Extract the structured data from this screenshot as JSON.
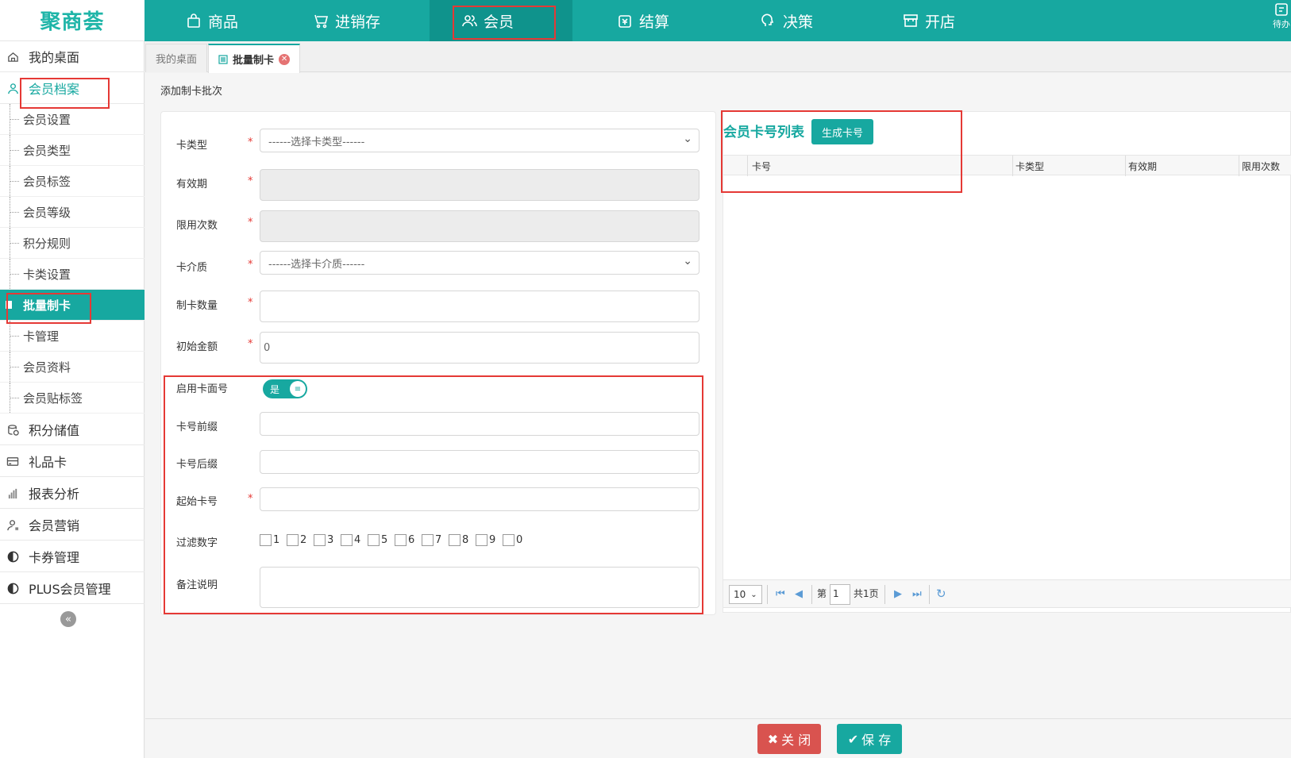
{
  "brand": {
    "logo_text": "聚商荟"
  },
  "topnav": [
    {
      "label": "商品",
      "icon": "bag-icon"
    },
    {
      "label": "进销存",
      "icon": "shelf-icon"
    },
    {
      "label": "会员",
      "icon": "users-icon",
      "active": true
    },
    {
      "label": "结算",
      "icon": "wallet-icon"
    },
    {
      "label": "决策",
      "icon": "brain-icon"
    },
    {
      "label": "开店",
      "icon": "store-icon"
    }
  ],
  "topnav_right_label": "待办",
  "sidebar": {
    "home": "我的桌面",
    "member_files": "会员档案",
    "sub_items": [
      "会员设置",
      "会员类型",
      "会员标签",
      "会员等级",
      "积分规则",
      "卡类设置",
      "批量制卡",
      "卡管理",
      "会员资料",
      "会员贴标签"
    ],
    "groups": [
      "积分储值",
      "礼品卡",
      "报表分析",
      "会员营销",
      "卡券管理",
      "PLUS会员管理"
    ]
  },
  "tabs": {
    "desktop": "我的桌面",
    "batch": "批量制卡"
  },
  "breadcrumb": "添加制卡批次",
  "form": {
    "card_type_label": "卡类型",
    "card_type_placeholder": "------选择卡类型------",
    "validity_label": "有效期",
    "limit_label": "限用次数",
    "medium_label": "卡介质",
    "medium_placeholder": "------选择卡介质------",
    "qty_label": "制卡数量",
    "amount_label": "初始金额",
    "amount_value": "0",
    "enable_label": "启用卡面号",
    "toggle_text": "是",
    "prefix_label": "卡号前缀",
    "suffix_label": "卡号后缀",
    "start_label": "起始卡号",
    "filter_label": "过滤数字",
    "filter_digits": [
      "1",
      "2",
      "3",
      "4",
      "5",
      "6",
      "7",
      "8",
      "9",
      "0"
    ],
    "remark_label": "备注说明",
    "required_mark": "*"
  },
  "card_list": {
    "title": "会员卡号列表",
    "generate_button": "生成卡号",
    "columns": [
      "卡号",
      "卡类型",
      "有效期",
      "限用次数"
    ]
  },
  "pager": {
    "page_size": "10",
    "page_prefix": "第",
    "page_value": "1",
    "total_text": "共1页"
  },
  "footer": {
    "close": "关 闭",
    "save": "保 存"
  }
}
